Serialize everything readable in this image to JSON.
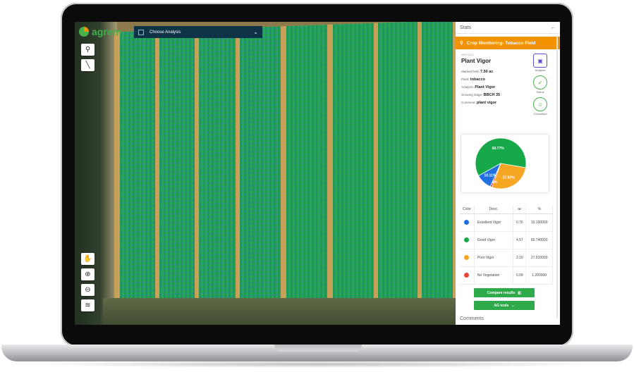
{
  "app": {
    "logo_text": "agrem",
    "analysis_select": "Choose Analysis"
  },
  "panel": {
    "header": "Stats",
    "back_icon": "←",
    "field_name": "Crop Monitoring- Tobacco Field",
    "date": "09/27/2022",
    "title": "Plant Vigor",
    "rows": [
      {
        "label": "Marked field:",
        "value": "7.50 ac"
      },
      {
        "label": "Plant:",
        "value": "tobacco"
      },
      {
        "label": "Analysis:",
        "value": "Plant Vigor"
      },
      {
        "label": "Growing stage:",
        "value": "BBCH 35"
      },
      {
        "label": "Comment:",
        "value": "plant vigor"
      }
    ],
    "icons": {
      "analysis": "Analysis",
      "status": "Status",
      "consultant": "Consultant"
    },
    "legend_headers": {
      "color": "Color",
      "desc": "Desc.",
      "ac": "ac",
      "pct": "%"
    },
    "legend_rows": [
      {
        "color": "#1f6fe0",
        "desc": "Excellent Vigor",
        "ac": "0.76",
        "pct": "10.100000"
      },
      {
        "color": "#17a84a",
        "desc": "Good Vigor",
        "ac": "4.57",
        "pct": "60.740000"
      },
      {
        "color": "#f5a623",
        "desc": "Poor Vigor",
        "ac": "2.10",
        "pct": "27.910000"
      },
      {
        "color": "#e8453c",
        "desc": "No Vegetation",
        "ac": "0.09",
        "pct": "1.200000"
      }
    ],
    "compare_btn": "Compare results",
    "ag_tools_btn": "AG tools",
    "comments": "Comments"
  },
  "chart_data": {
    "type": "pie",
    "slices": [
      {
        "label": "60.77%",
        "value": 60.77,
        "color": "#17a84a"
      },
      {
        "label": "27.92%",
        "value": 27.92,
        "color": "#f5a623"
      },
      {
        "label": "1.2%",
        "value": 1.2,
        "color": "#e8453c"
      },
      {
        "label": "10.11%",
        "value": 10.11,
        "color": "#1f6fe0"
      }
    ]
  }
}
